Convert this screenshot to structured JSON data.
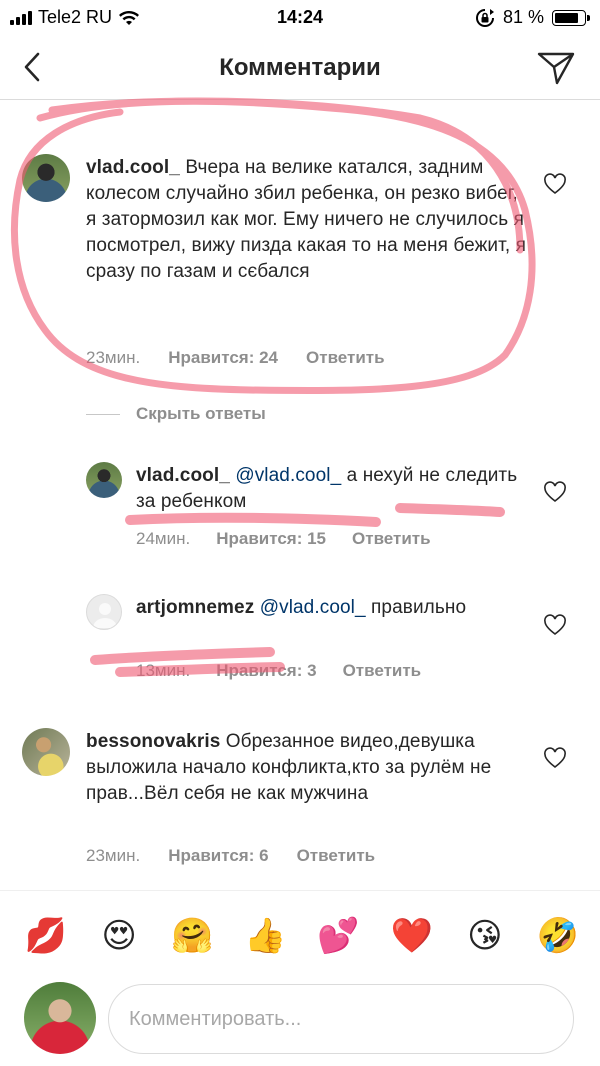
{
  "status_bar": {
    "carrier": "Tele2 RU",
    "time": "14:24",
    "battery": "81 %",
    "battery_level": 0.81
  },
  "header": {
    "title": "Комментарии",
    "back_icon": "chevron-left-icon",
    "share_icon": "paper-plane-icon"
  },
  "comments": [
    {
      "username": "vlad.cool_",
      "text": "Вчера на велике катался, задним колесом случайно збил ребенка, он резко вибег, я затормозил как мог. Ему ничего не случилось я посмотрел, вижу пизда какая то на меня бежит, я сразу по газам и сєбался",
      "time": "23мин.",
      "likes": "Нравится: 24",
      "reply": "Ответить"
    },
    {
      "username": "vlad.cool_",
      "mention": "@vlad.cool_",
      "text": "а нехуй не следить за ребенком",
      "time": "24мин.",
      "likes": "Нравится: 15",
      "reply": "Ответить"
    },
    {
      "username": "artjomnemez",
      "mention": "@vlad.cool_",
      "text": "правильно",
      "time": "13мин.",
      "likes": "Нравится: 3",
      "reply": "Ответить"
    },
    {
      "username": "bessonovakris",
      "text": "Обрезанное видео,девушка выложила начало конфликта,кто за рулём не прав...Вёл себя не как мужчина",
      "time": "23мин.",
      "likes": "Нравится: 6",
      "reply": "Ответить"
    }
  ],
  "hide_replies": "Скрыть ответы",
  "emoji_bar": [
    "💋",
    "😍",
    "🤗",
    "👍",
    "💕",
    "❤️",
    "😘",
    "🤣"
  ],
  "input": {
    "placeholder": "Комментировать..."
  },
  "colors": {
    "marker": "#f05a73",
    "link": "#003569",
    "secondary_text": "#8e8e8e"
  }
}
